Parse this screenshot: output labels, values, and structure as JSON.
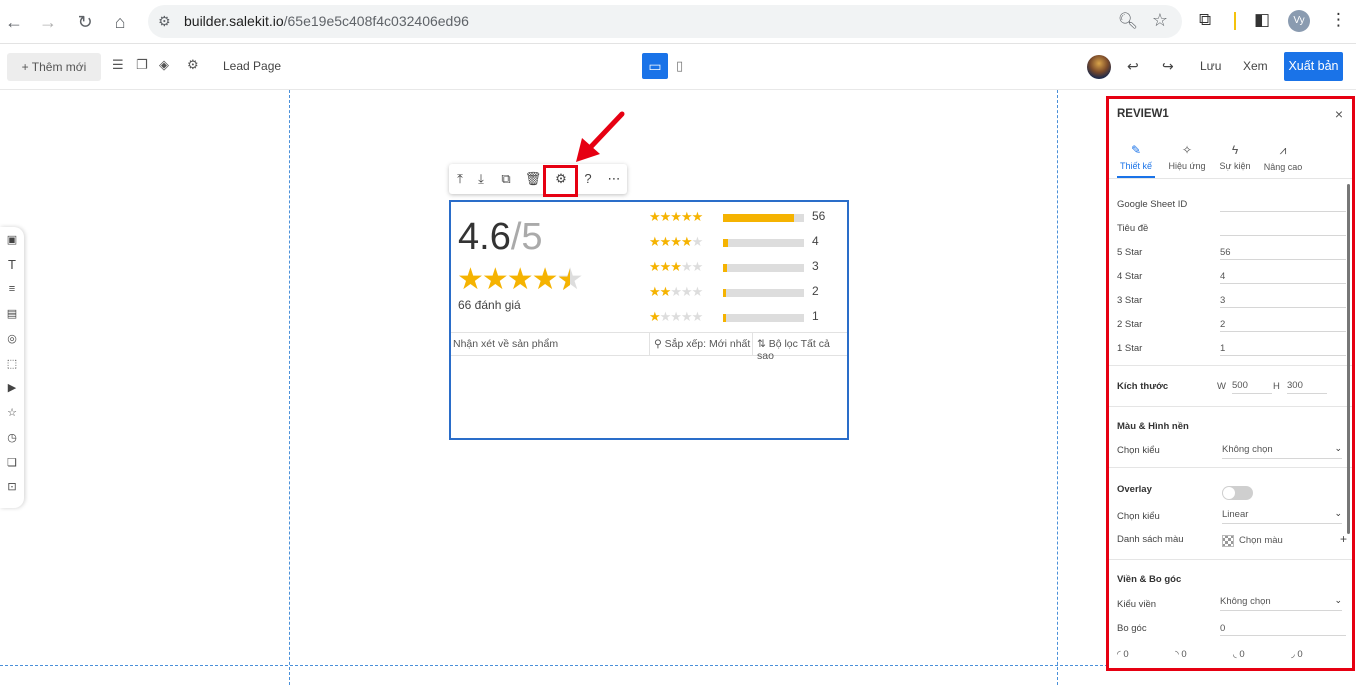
{
  "browser": {
    "url_host": "builder.salekit.io",
    "url_path": "/65e19e5c408f4c032406ed96",
    "profile_initials": "Vy"
  },
  "toolbar": {
    "new_label": "+ Thêm mới",
    "page_name": "Lead Page",
    "save_label": "Lưu",
    "view_label": "Xem",
    "publish_label": "Xuất bản"
  },
  "review": {
    "rating": "4.6",
    "rating_max": "/5",
    "review_count": "66 đánh giá",
    "distribution": [
      {
        "stars": 5,
        "count": "56",
        "fill": 0.88
      },
      {
        "stars": 4,
        "count": "4",
        "fill": 0.06
      },
      {
        "stars": 3,
        "count": "3",
        "fill": 0.05
      },
      {
        "stars": 2,
        "count": "2",
        "fill": 0.03
      },
      {
        "stars": 1,
        "count": "1",
        "fill": 0.02
      }
    ],
    "comments_label": "Nhận xét về sản phẩm",
    "sort_label": "Sắp xếp: Mới nhất",
    "filter_label": "Bộ lọc Tất cả sao"
  },
  "panel": {
    "title": "REVIEW1",
    "close": "×",
    "tabs": [
      {
        "label": "Thiết kế",
        "icon": "pencil-icon"
      },
      {
        "label": "Hiệu ứng",
        "icon": "magic-wand-icon"
      },
      {
        "label": "Sự kiện",
        "icon": "lightning-icon"
      },
      {
        "label": "Nâng cao",
        "icon": "advanced-icon"
      }
    ],
    "fields": [
      {
        "label": "Google Sheet ID",
        "value": ""
      },
      {
        "label": "Tiêu đề",
        "value": ""
      },
      {
        "label": "5 Star",
        "value": "56"
      },
      {
        "label": "4 Star",
        "value": "4"
      },
      {
        "label": "3 Star",
        "value": "3"
      },
      {
        "label": "2 Star",
        "value": "2"
      },
      {
        "label": "1 Star",
        "value": "1"
      }
    ],
    "size_section": "Kích thước",
    "width_label": "W",
    "width_value": "500",
    "height_label": "H",
    "height_value": "300",
    "color_section": "Màu & Hình nền",
    "choose_style_label": "Chọn kiểu",
    "bg_style_value": "Không chọn",
    "overlay_section": "Overlay",
    "overlay_style_label": "Chọn kiểu",
    "overlay_style_value": "Linear",
    "color_list_label": "Danh sách màu",
    "color_pick_label": "Chọn màu",
    "border_section": "Viền & Bo góc",
    "border_style_label": "Kiểu viền",
    "border_style_value": "Không chọn",
    "radius_label": "Bo góc",
    "radius_value": "0",
    "corner_values": [
      "0",
      "0",
      "0",
      "0"
    ]
  }
}
